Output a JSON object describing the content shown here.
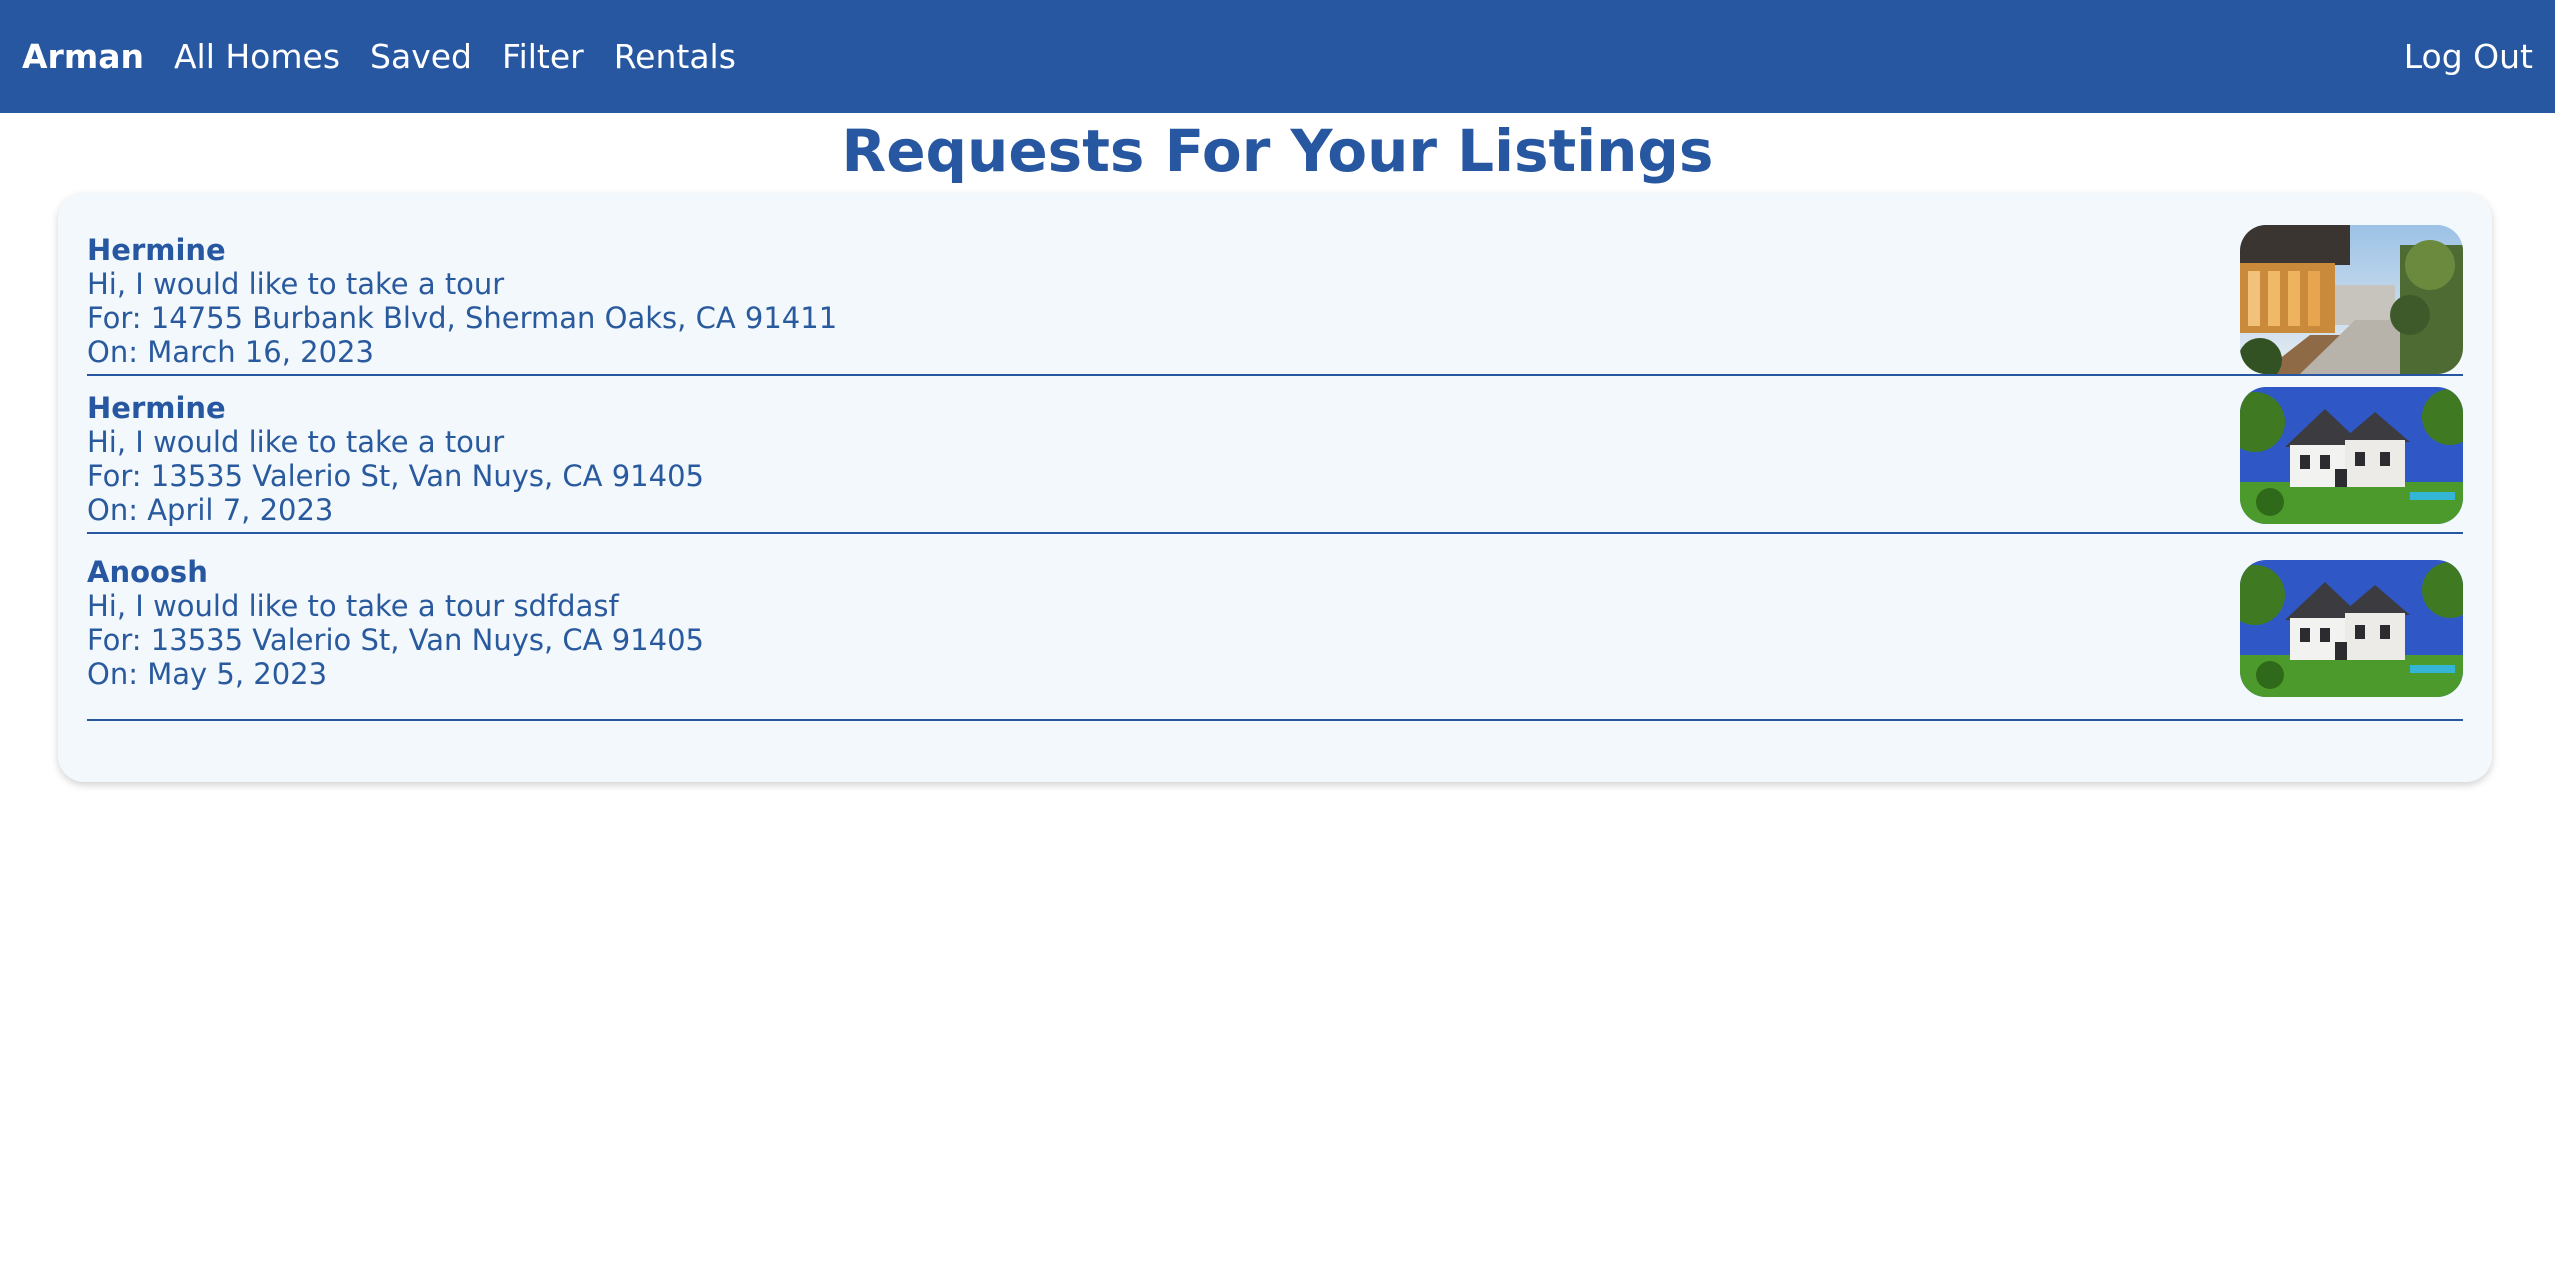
{
  "nav": {
    "brand": "Arman",
    "links": [
      "All Homes",
      "Saved",
      "Filter",
      "Rentals"
    ],
    "logout": "Log Out"
  },
  "page": {
    "title": "Requests For Your Listings"
  },
  "requests": [
    {
      "name": "Hermine",
      "message": "Hi, I would like to take a tour",
      "for": "For: 14755 Burbank Blvd, Sherman Oaks, CA 91411",
      "on": "On: March 16, 2023",
      "image": "modern-house-patio-photo"
    },
    {
      "name": "Hermine",
      "message": "Hi, I would like to take a tour",
      "for": "For: 13535 Valerio St, Van Nuys, CA 91405",
      "on": "On: April 7, 2023",
      "image": "white-farmhouse-photo"
    },
    {
      "name": "Anoosh",
      "message": "Hi, I would like to take a tour sdfdasf",
      "for": "For: 13535 Valerio St, Van Nuys, CA 91405",
      "on": "On: May 5, 2023",
      "image": "white-farmhouse-photo"
    }
  ],
  "colors": {
    "brand": "#2757a0",
    "card_bg": "#f3f8fc"
  }
}
